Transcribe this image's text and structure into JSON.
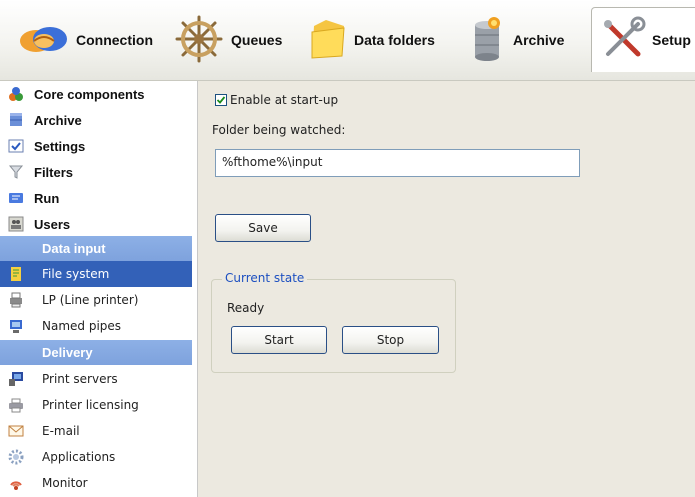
{
  "toolbar": {
    "items": [
      {
        "label": "Connection",
        "icon": "handshake-icon"
      },
      {
        "label": "Queues",
        "icon": "ship-wheel-icon"
      },
      {
        "label": "Data folders",
        "icon": "folder-icon"
      },
      {
        "label": "Archive",
        "icon": "database-archive-icon"
      },
      {
        "label": "Setup",
        "icon": "tools-icon"
      }
    ]
  },
  "sidebar": {
    "items": [
      {
        "label": "Core components",
        "icon": "components-icon"
      },
      {
        "label": "Archive",
        "icon": "archive-icon"
      },
      {
        "label": "Settings",
        "icon": "settings-checklist-icon"
      },
      {
        "label": "Filters",
        "icon": "filter-funnel-icon"
      },
      {
        "label": "Run",
        "icon": "run-icon"
      },
      {
        "label": "Users",
        "icon": "users-icon"
      }
    ],
    "data_input_header": "Data input",
    "data_input_items": [
      {
        "label": "File system",
        "icon": "file-system-icon",
        "selected": true
      },
      {
        "label": "LP (Line printer)",
        "icon": "line-printer-icon"
      },
      {
        "label": "Named pipes",
        "icon": "named-pipes-icon"
      }
    ],
    "delivery_header": "Delivery",
    "delivery_items": [
      {
        "label": "Print servers",
        "icon": "print-server-icon"
      },
      {
        "label": "Printer licensing",
        "icon": "printer-icon"
      },
      {
        "label": "E-mail",
        "icon": "envelope-icon"
      },
      {
        "label": "Applications",
        "icon": "gear-icon"
      },
      {
        "label": "Monitor",
        "icon": "monitor-signal-icon"
      }
    ]
  },
  "main": {
    "enable_label": "Enable at start-up",
    "enable_checked": true,
    "folder_label": "Folder being watched:",
    "folder_value": "%fthome%\\input",
    "save_label": "Save",
    "state_group_title": "Current state",
    "state_value": "Ready",
    "start_label": "Start",
    "stop_label": "Stop"
  },
  "colors": {
    "selection": "#3361b8",
    "category_header": "#86a9e2",
    "panel_background": "#ece9e0",
    "group_title": "#1c4fc0"
  }
}
